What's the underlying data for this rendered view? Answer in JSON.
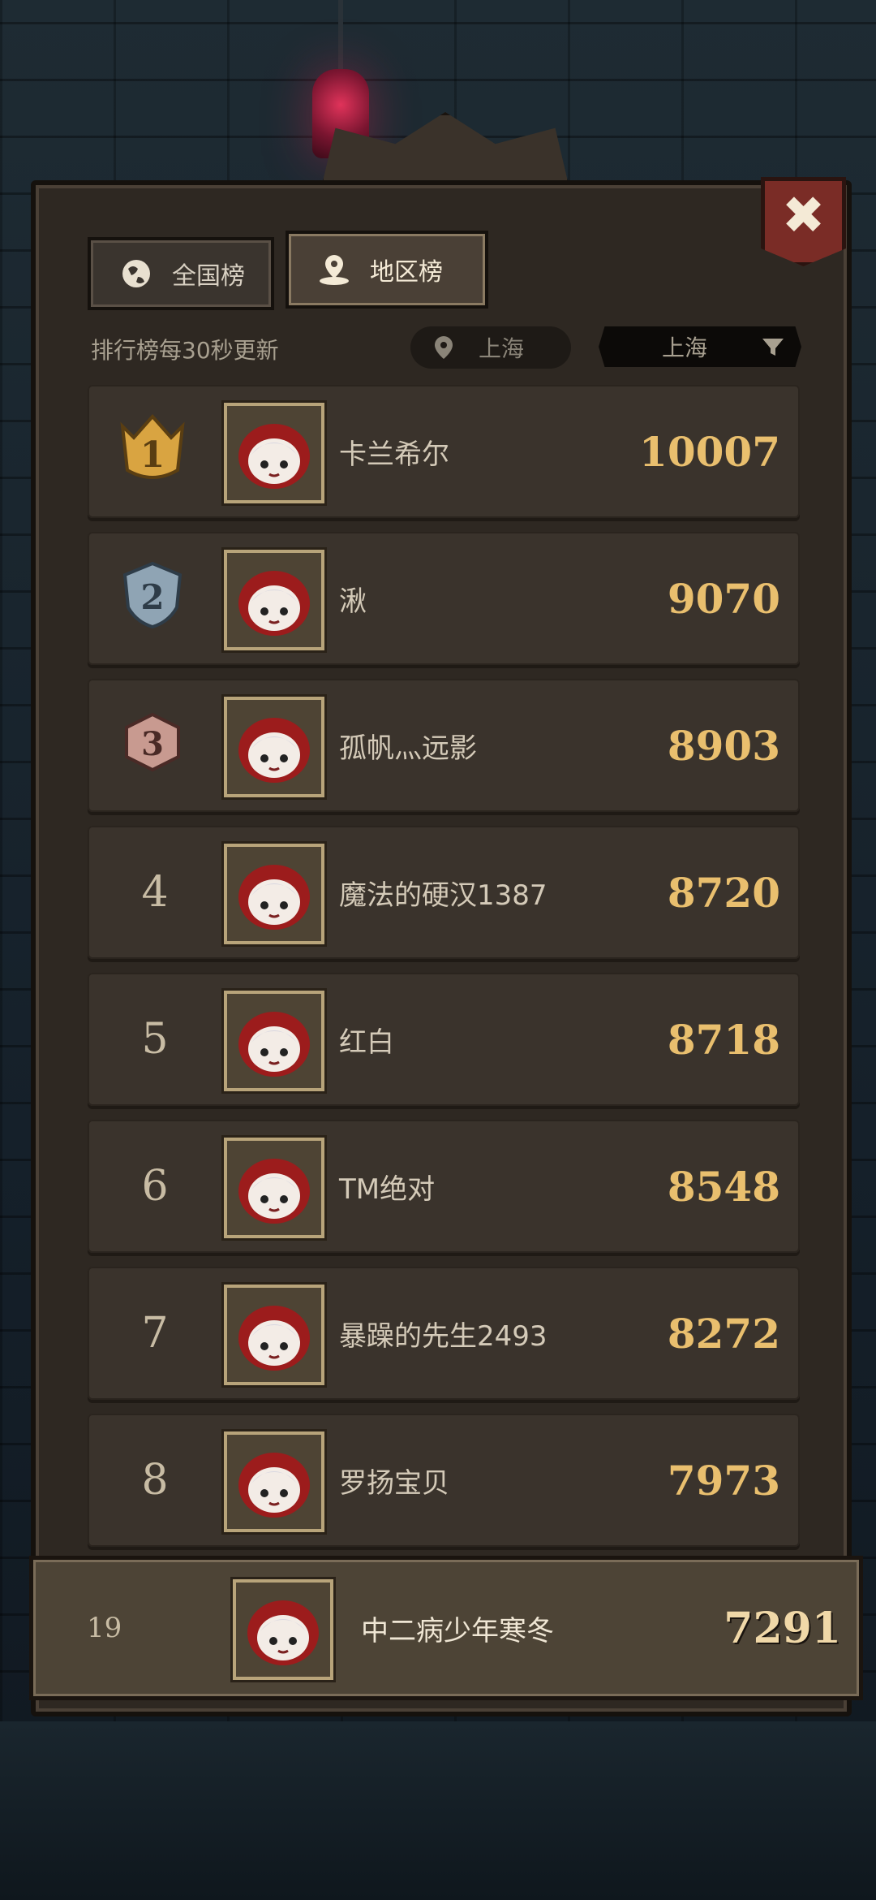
{
  "tabs": {
    "national": "全国榜",
    "regional": "地区榜"
  },
  "update_note": "排行榜每30秒更新",
  "location": {
    "current": "上海",
    "selected": "上海"
  },
  "close_label": "✖",
  "rows": [
    {
      "rank": "1",
      "name": "卡兰希尔",
      "score": "10007"
    },
    {
      "rank": "2",
      "name": "湫",
      "score": "9070"
    },
    {
      "rank": "3",
      "name": "孤帆灬远影",
      "score": "8903"
    },
    {
      "rank": "4",
      "name": "魔法的硬汉1387",
      "score": "8720"
    },
    {
      "rank": "5",
      "name": "红白",
      "score": "8718"
    },
    {
      "rank": "6",
      "name": "TM绝对",
      "score": "8548"
    },
    {
      "rank": "7",
      "name": "暴躁的先生2493",
      "score": "8272"
    },
    {
      "rank": "8",
      "name": "罗扬宝贝",
      "score": "7973"
    }
  ],
  "self": {
    "rank": "19",
    "name": "中二病少年寒冬",
    "score": "7291"
  },
  "colors": {
    "gold": "#d9a441",
    "silver": "#8fa4b4",
    "bronze": "#c89a90",
    "score": "#e9bf6e"
  }
}
